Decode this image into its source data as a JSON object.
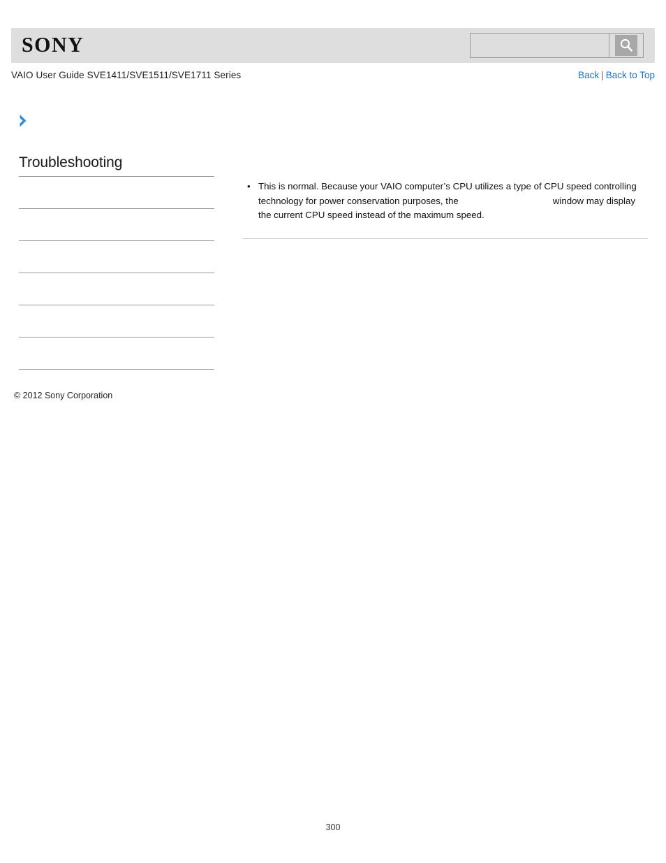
{
  "header": {
    "logo_text": "SONY",
    "logo_icon": "sony-wordmark",
    "search": {
      "value": "",
      "placeholder": "",
      "button_icon": "search-magnifier-icon"
    }
  },
  "sub_header": {
    "guide_title": "VAIO User Guide SVE1411/SVE1511/SVE1711 Series",
    "nav": {
      "back_label": "Back",
      "separator": "|",
      "back_to_top_label": "Back to Top"
    }
  },
  "breadcrumb": {
    "chevron_icon": "chevron-right-icon",
    "chevron_color": "#2f8fd4",
    "label": ""
  },
  "sidebar": {
    "section_title": "Troubleshooting",
    "items": [
      {
        "label": ""
      },
      {
        "label": ""
      },
      {
        "label": ""
      },
      {
        "label": ""
      },
      {
        "label": ""
      },
      {
        "label": ""
      }
    ]
  },
  "main": {
    "answers": [
      {
        "bullet": "•",
        "text_before": "This is normal. Because your VAIO computer’s CPU utilizes a type of CPU speed controlling technology for power conservation purposes, the",
        "ui_name": "",
        "text_after": "window may display the current CPU speed instead of the maximum speed."
      }
    ]
  },
  "footer": {
    "copyright": "© 2012 Sony Corporation",
    "page_number": "300"
  },
  "colors": {
    "header_bg": "#dedede",
    "link_blue": "#1a73c8",
    "rule_gray": "#9b9b9b",
    "content_rule_gray": "#cfcfcf",
    "accent_chevron": "#2f8fd4"
  }
}
